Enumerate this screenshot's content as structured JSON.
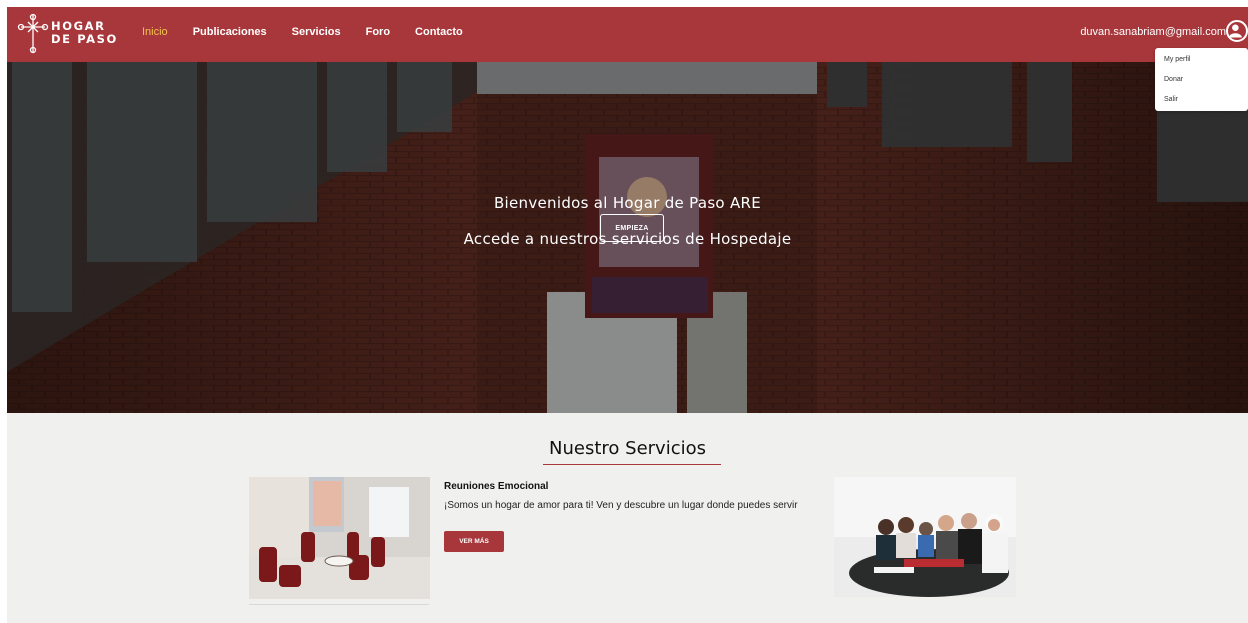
{
  "brand": {
    "line1": "HOGAR",
    "line2": "DE PASO"
  },
  "nav": [
    {
      "label": "Inicio",
      "active": true
    },
    {
      "label": "Publicaciones",
      "active": false
    },
    {
      "label": "Servicios",
      "active": false
    },
    {
      "label": "Foro",
      "active": false
    },
    {
      "label": "Contacto",
      "active": false
    }
  ],
  "user": {
    "email": "duvan.sanabriam@gmail.com",
    "menu": [
      "My perfil",
      "Donar",
      "Salir"
    ]
  },
  "hero": {
    "title": "Bienvenidos al Hogar de Paso ARE",
    "subtitle": "Accede a nuestros servicios de Hospedaje",
    "button": "EMPIEZA"
  },
  "services": {
    "title": "Nuestro Servicios",
    "item": {
      "name": "Reuniones Emocional",
      "description": "¡Somos un hogar de amor para ti! Ven y descubre un lugar donde puedes servir",
      "button": "VER MÁS"
    }
  },
  "colors": {
    "primary": "#a8373b",
    "accent": "#f0c44e",
    "background": "#f0f1ef"
  }
}
